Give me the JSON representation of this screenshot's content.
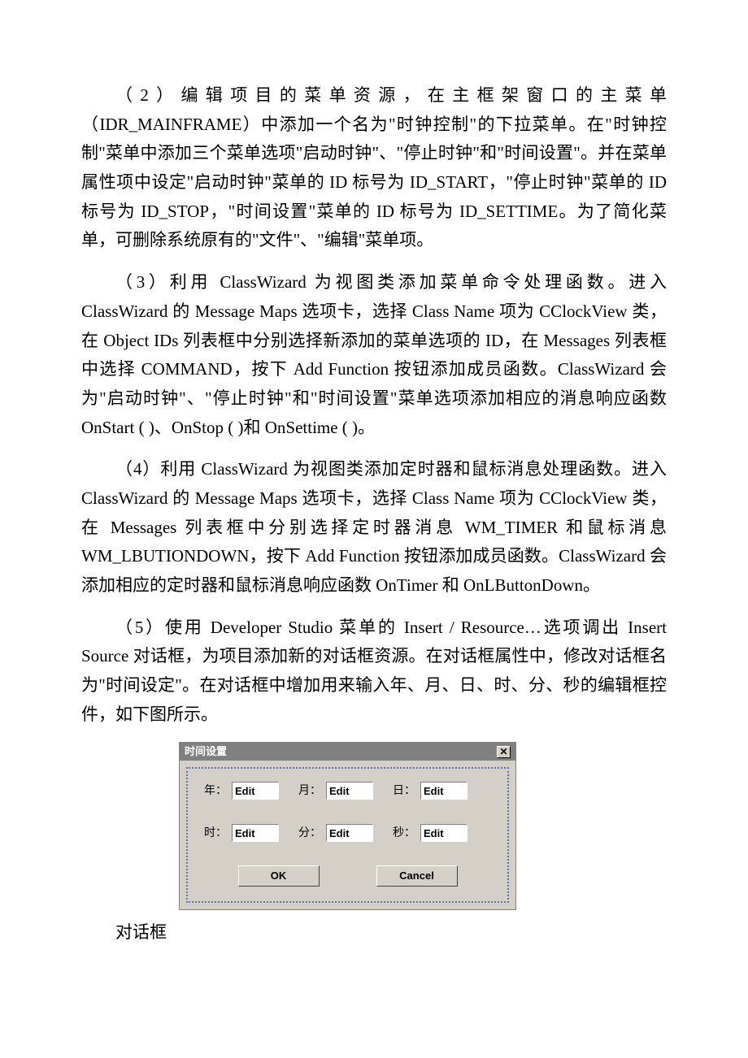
{
  "paragraphs": {
    "p2": "（2）编辑项目的菜单资源，在主框架窗口的主菜单（IDR_MAINFRAME）中添加一个名为\"时钟控制\"的下拉菜单。在\"时钟控制\"菜单中添加三个菜单选项\"启动时钟\"、\"停止时钟\"和\"时间设置\"。并在菜单属性项中设定\"启动时钟\"菜单的 ID 标号为 ID_START，\"停止时钟\"菜单的 ID 标号为 ID_STOP，\"时间设置\"菜单的 ID 标号为 ID_SETTIME。为了简化菜单，可删除系统原有的\"文件\"、\"编辑\"菜单项。",
    "p3": "（3）利用 ClassWizard 为视图类添加菜单命令处理函数。进入 ClassWizard 的 Message Maps 选项卡，选择 Class Name 项为 CClockView 类，在 Object IDs 列表框中分别选择新添加的菜单选项的 ID，在 Messages 列表框中选择 COMMAND，按下 Add Function 按钮添加成员函数。ClassWizard 会为\"启动时钟\"、\"停止时钟\"和\"时间设置\"菜单选项添加相应的消息响应函数 OnStart ( )、OnStop ( )和 OnSettime ( )。",
    "p4": "（4）利用 ClassWizard 为视图类添加定时器和鼠标消息处理函数。进入 ClassWizard 的 Message Maps 选项卡，选择 Class Name 项为 CClockView 类，在 Messages 列表框中分别选择定时器消息 WM_TIMER 和鼠标消息 WM_LBUTIONDOWN，按下 Add Function 按钮添加成员函数。ClassWizard 会添加相应的定时器和鼠标消息响应函数 OnTimer 和 OnLButtonDown。",
    "p5": "（5）使用 Developer Studio 菜单的 Insert / Resource…选项调出 Insert Source 对话框，为项目添加新的对话框资源。在对话框属性中，修改对话框名为\"时间设定\"。在对话框中增加用来输入年、月、日、时、分、秒的编辑框控件，如下图所示。"
  },
  "dialog": {
    "title": "时间设置",
    "labels": {
      "year": "年：",
      "month": "月：",
      "day": "日：",
      "hour": "时：",
      "minute": "分：",
      "second": "秒："
    },
    "placeholder": "Edit",
    "buttons": {
      "ok": "OK",
      "cancel": "Cancel"
    }
  },
  "caption": "对话框"
}
